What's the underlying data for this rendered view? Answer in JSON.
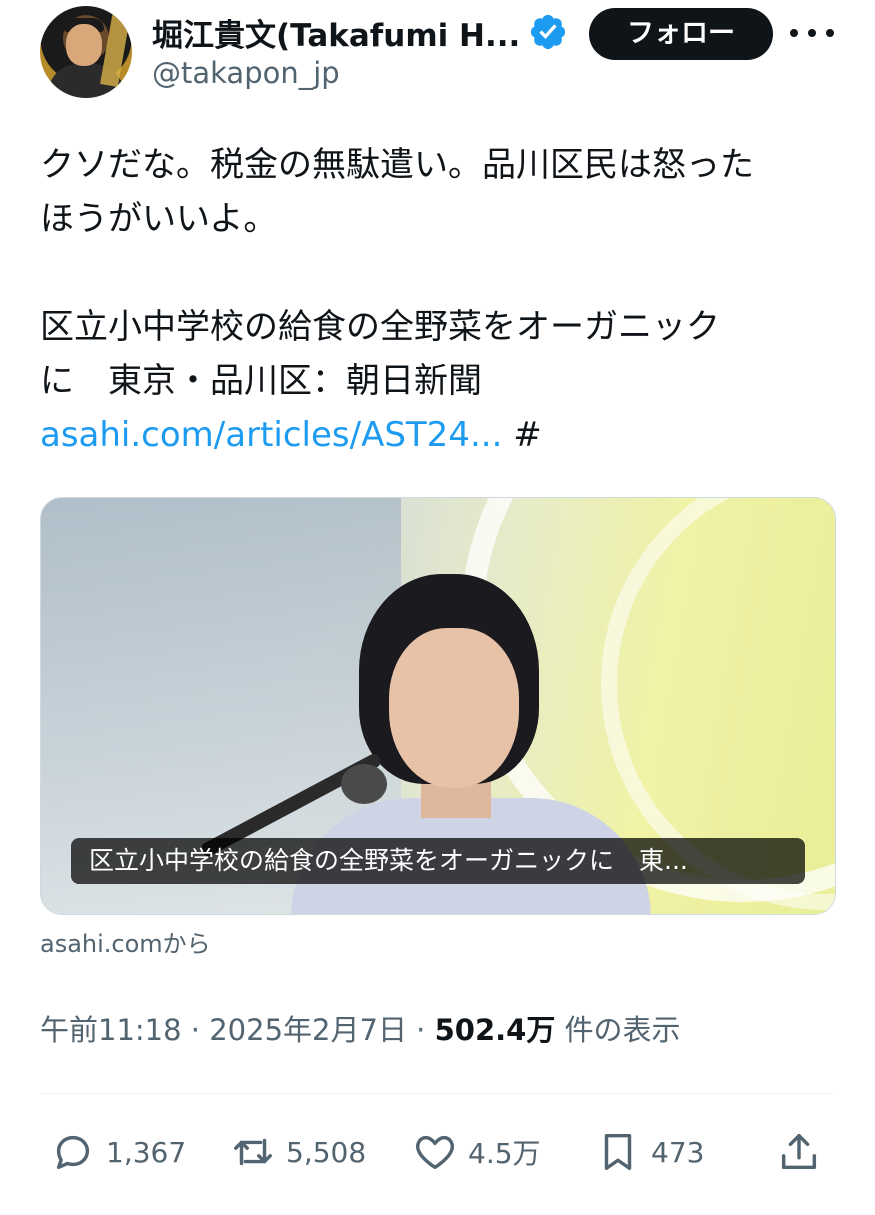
{
  "author": {
    "display_name": "堀江貴文(Takafumi H...",
    "handle": "@takapon_jp",
    "verified_badge": "verified-check-icon"
  },
  "header": {
    "follow_label": "フォロー",
    "more_icon": "more-dots-icon"
  },
  "tweet": {
    "lines": [
      "クソだな。税金の無駄遣い。品川区民は怒った",
      "ほうがいいよ。",
      "",
      "区立小中学校の給食の全野菜をオーガニック",
      "に　東京・品川区：朝日新聞"
    ],
    "link_text": "asahi.com/articles/AST24...",
    "hashtag": "#"
  },
  "card": {
    "caption": "区立小中学校の給食の全野菜をオーガニックに　東...",
    "source": "asahi.comから"
  },
  "meta": {
    "time": "午前11:18",
    "sep1": " · ",
    "date": "2025年2月7日",
    "sep2": " · ",
    "views_count": "502.4万",
    "views_label": " 件の表示"
  },
  "actions": {
    "replies": "1,367",
    "reposts": "5,508",
    "likes": "4.5万",
    "bookmarks": "473"
  },
  "colors": {
    "link": "#1d9bf0",
    "secondary_text": "#536471",
    "primary_text": "#0f1419",
    "follow_bg": "#0f1419"
  }
}
